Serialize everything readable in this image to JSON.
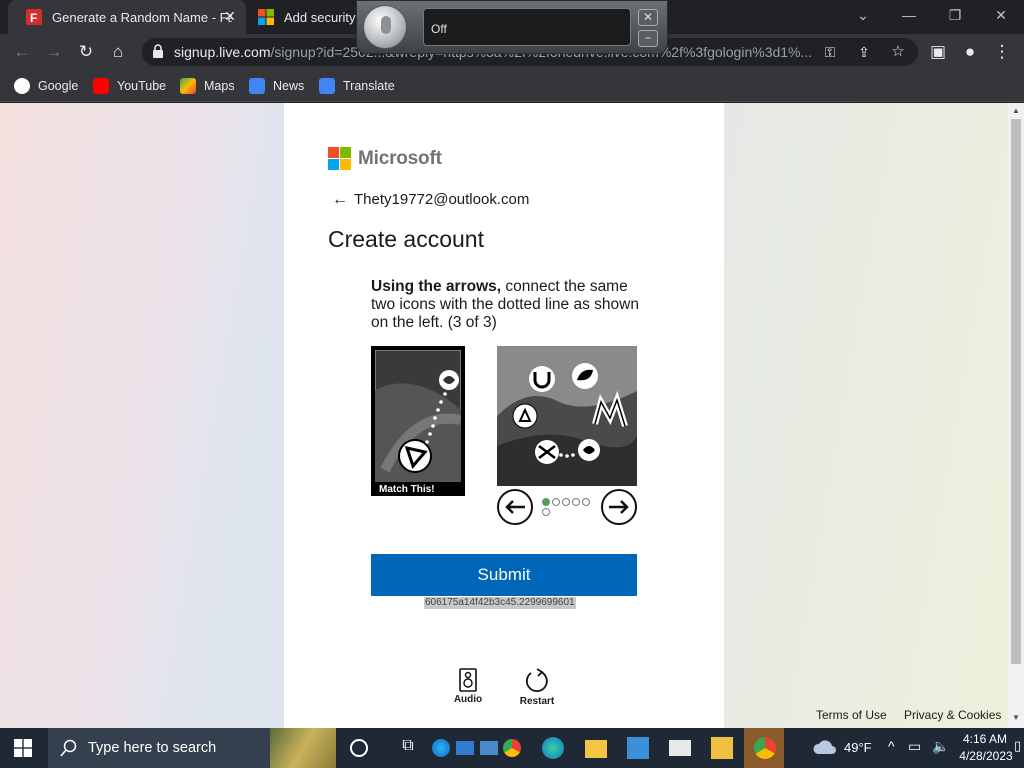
{
  "browser": {
    "tabs": [
      {
        "title": "Generate a Random Name - Fake",
        "active": true
      },
      {
        "title": "Add security",
        "active": false
      }
    ],
    "url_host": "signup.live.com",
    "url_rest": "/signup?id=2502...&wreply=https%3a%2f%2fonedrive.live.com%2f%3fgologin%3d1%...",
    "bookmarks": [
      "Google",
      "YouTube",
      "Maps",
      "News",
      "Translate"
    ]
  },
  "voice_widget": {
    "status": "Off"
  },
  "page": {
    "brand": "Microsoft",
    "email": "Thety19772@outlook.com",
    "title": "Create account",
    "instruction_bold": "Using the arrows,",
    "instruction_rest": " connect the same two icons with the dotted line as shown on the left. (3 of 3)",
    "match_label": "Match This!",
    "submit_label": "Submit",
    "session_id": "606175a14f42b3c45.2299699601",
    "audio_label": "Audio",
    "restart_label": "Restart",
    "footer_terms": "Terms of Use",
    "footer_privacy": "Privacy & Cookies",
    "pager": {
      "total": 6,
      "current": 1
    }
  },
  "taskbar": {
    "search_placeholder": "Type here to search",
    "weather": "49°F",
    "time": "4:16 AM",
    "date": "4/28/2023"
  },
  "colors": {
    "submit": "#0067b8",
    "ms_red": "#f25022",
    "ms_green": "#7fba00",
    "ms_blue": "#00a4ef",
    "ms_yellow": "#ffb900"
  },
  "icons": [
    "search-icon",
    "microphone-icon",
    "back-arrow-icon",
    "lock-icon",
    "star-icon",
    "profile-icon",
    "speaker-icon",
    "restart-icon",
    "windows-start-icon",
    "cloud-icon"
  ]
}
